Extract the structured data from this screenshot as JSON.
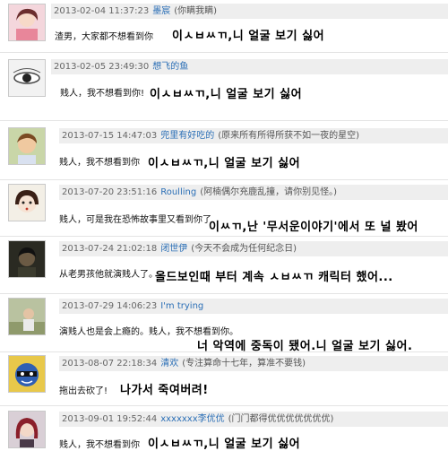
{
  "comments": [
    {
      "time": "2013-02-04 11:37:23",
      "user": "墨宸",
      "note": "(你瞒我瞒)",
      "text_cn": "渣男，大家都不想看到你",
      "text_kr": "이ㅅㅂㅆㄲ,니 얼굴 보기 싫어",
      "avatar": "girl-pink-avatar"
    },
    {
      "time": "2013-02-05 23:49:30",
      "user": "想飞的鱼",
      "note": "",
      "text_cn": "贱人，我不想看到你!",
      "text_kr": "이ㅅㅂㅆㄲ,니 얼굴 보기 싫어",
      "avatar": "eye-sketch-avatar"
    },
    {
      "time": "2013-07-15 14:47:03",
      "user": "兜里有好吃的",
      "note": "(原来所有所得所获不如一夜的星空)",
      "text_cn": "贱人，我不想看到你",
      "text_kr": "이ㅅㅂㅆㄲ,니 얼굴 보기 싫어",
      "avatar": "child-avatar"
    },
    {
      "time": "2013-07-20 23:51:16",
      "user": "Roulling",
      "note": "(阿楠偶尔充鹿乱撞，请你别见怪。)",
      "text_cn": "贱人，可是我在恐怖故事里又看到你了",
      "text_kr": "이ㅆㄲ,난 '무서운이야기'에서 또 널 봤어",
      "avatar": "doll-avatar"
    },
    {
      "time": "2013-07-24 21:02:18",
      "user": "闭世伊",
      "note": "(今天不会成为任何纪念日)",
      "text_cn": "从老男孩他就演贱人了。",
      "text_kr": "올드보인때 부터 계속 ㅅㅂㅆㄲ 캐릭터 했어...",
      "avatar": "dark-portrait-avatar"
    },
    {
      "time": "2013-07-29 14:06:23",
      "user": "I'm trying",
      "note": "",
      "text_cn": "演贱人也是会上瘾的。贱人，我不想看到你。",
      "text_kr": "너 악역에 중독이 됐어.니 얼굴 보기 싫어.",
      "avatar": "outdoor-avatar"
    },
    {
      "time": "2013-08-07 22:18:34",
      "user": "清欢",
      "note": "(专注算命十七年，算准不要钱)",
      "text_cn": "拖出去砍了!",
      "text_kr": "나가서 죽여버려!",
      "avatar": "cartoon-hero-avatar"
    },
    {
      "time": "2013-09-01 19:52:44",
      "user": "xxxxxxx李优优",
      "note": "(门门都得优优优优优优优)",
      "text_cn": "贱人，我不想看到你",
      "text_kr": "이ㅅㅂㅆㄲ,니 얼굴 보기 싫어",
      "avatar": "red-hair-avatar"
    }
  ]
}
